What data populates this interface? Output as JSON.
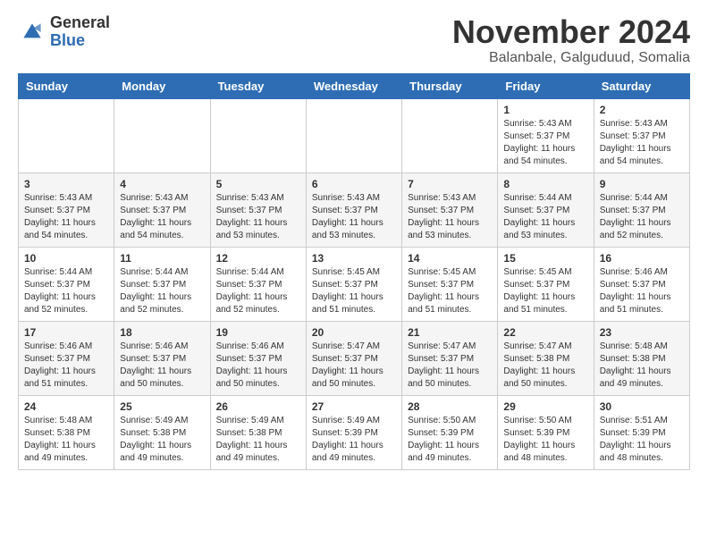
{
  "logo": {
    "general": "General",
    "blue": "Blue"
  },
  "header": {
    "month": "November 2024",
    "location": "Balanbale, Galguduud, Somalia"
  },
  "weekdays": [
    "Sunday",
    "Monday",
    "Tuesday",
    "Wednesday",
    "Thursday",
    "Friday",
    "Saturday"
  ],
  "weeks": [
    [
      {
        "day": "",
        "info": ""
      },
      {
        "day": "",
        "info": ""
      },
      {
        "day": "",
        "info": ""
      },
      {
        "day": "",
        "info": ""
      },
      {
        "day": "",
        "info": ""
      },
      {
        "day": "1",
        "info": "Sunrise: 5:43 AM\nSunset: 5:37 PM\nDaylight: 11 hours\nand 54 minutes."
      },
      {
        "day": "2",
        "info": "Sunrise: 5:43 AM\nSunset: 5:37 PM\nDaylight: 11 hours\nand 54 minutes."
      }
    ],
    [
      {
        "day": "3",
        "info": "Sunrise: 5:43 AM\nSunset: 5:37 PM\nDaylight: 11 hours\nand 54 minutes."
      },
      {
        "day": "4",
        "info": "Sunrise: 5:43 AM\nSunset: 5:37 PM\nDaylight: 11 hours\nand 54 minutes."
      },
      {
        "day": "5",
        "info": "Sunrise: 5:43 AM\nSunset: 5:37 PM\nDaylight: 11 hours\nand 53 minutes."
      },
      {
        "day": "6",
        "info": "Sunrise: 5:43 AM\nSunset: 5:37 PM\nDaylight: 11 hours\nand 53 minutes."
      },
      {
        "day": "7",
        "info": "Sunrise: 5:43 AM\nSunset: 5:37 PM\nDaylight: 11 hours\nand 53 minutes."
      },
      {
        "day": "8",
        "info": "Sunrise: 5:44 AM\nSunset: 5:37 PM\nDaylight: 11 hours\nand 53 minutes."
      },
      {
        "day": "9",
        "info": "Sunrise: 5:44 AM\nSunset: 5:37 PM\nDaylight: 11 hours\nand 52 minutes."
      }
    ],
    [
      {
        "day": "10",
        "info": "Sunrise: 5:44 AM\nSunset: 5:37 PM\nDaylight: 11 hours\nand 52 minutes."
      },
      {
        "day": "11",
        "info": "Sunrise: 5:44 AM\nSunset: 5:37 PM\nDaylight: 11 hours\nand 52 minutes."
      },
      {
        "day": "12",
        "info": "Sunrise: 5:44 AM\nSunset: 5:37 PM\nDaylight: 11 hours\nand 52 minutes."
      },
      {
        "day": "13",
        "info": "Sunrise: 5:45 AM\nSunset: 5:37 PM\nDaylight: 11 hours\nand 51 minutes."
      },
      {
        "day": "14",
        "info": "Sunrise: 5:45 AM\nSunset: 5:37 PM\nDaylight: 11 hours\nand 51 minutes."
      },
      {
        "day": "15",
        "info": "Sunrise: 5:45 AM\nSunset: 5:37 PM\nDaylight: 11 hours\nand 51 minutes."
      },
      {
        "day": "16",
        "info": "Sunrise: 5:46 AM\nSunset: 5:37 PM\nDaylight: 11 hours\nand 51 minutes."
      }
    ],
    [
      {
        "day": "17",
        "info": "Sunrise: 5:46 AM\nSunset: 5:37 PM\nDaylight: 11 hours\nand 51 minutes."
      },
      {
        "day": "18",
        "info": "Sunrise: 5:46 AM\nSunset: 5:37 PM\nDaylight: 11 hours\nand 50 minutes."
      },
      {
        "day": "19",
        "info": "Sunrise: 5:46 AM\nSunset: 5:37 PM\nDaylight: 11 hours\nand 50 minutes."
      },
      {
        "day": "20",
        "info": "Sunrise: 5:47 AM\nSunset: 5:37 PM\nDaylight: 11 hours\nand 50 minutes."
      },
      {
        "day": "21",
        "info": "Sunrise: 5:47 AM\nSunset: 5:37 PM\nDaylight: 11 hours\nand 50 minutes."
      },
      {
        "day": "22",
        "info": "Sunrise: 5:47 AM\nSunset: 5:38 PM\nDaylight: 11 hours\nand 50 minutes."
      },
      {
        "day": "23",
        "info": "Sunrise: 5:48 AM\nSunset: 5:38 PM\nDaylight: 11 hours\nand 49 minutes."
      }
    ],
    [
      {
        "day": "24",
        "info": "Sunrise: 5:48 AM\nSunset: 5:38 PM\nDaylight: 11 hours\nand 49 minutes."
      },
      {
        "day": "25",
        "info": "Sunrise: 5:49 AM\nSunset: 5:38 PM\nDaylight: 11 hours\nand 49 minutes."
      },
      {
        "day": "26",
        "info": "Sunrise: 5:49 AM\nSunset: 5:38 PM\nDaylight: 11 hours\nand 49 minutes."
      },
      {
        "day": "27",
        "info": "Sunrise: 5:49 AM\nSunset: 5:39 PM\nDaylight: 11 hours\nand 49 minutes."
      },
      {
        "day": "28",
        "info": "Sunrise: 5:50 AM\nSunset: 5:39 PM\nDaylight: 11 hours\nand 49 minutes."
      },
      {
        "day": "29",
        "info": "Sunrise: 5:50 AM\nSunset: 5:39 PM\nDaylight: 11 hours\nand 48 minutes."
      },
      {
        "day": "30",
        "info": "Sunrise: 5:51 AM\nSunset: 5:39 PM\nDaylight: 11 hours\nand 48 minutes."
      }
    ]
  ]
}
